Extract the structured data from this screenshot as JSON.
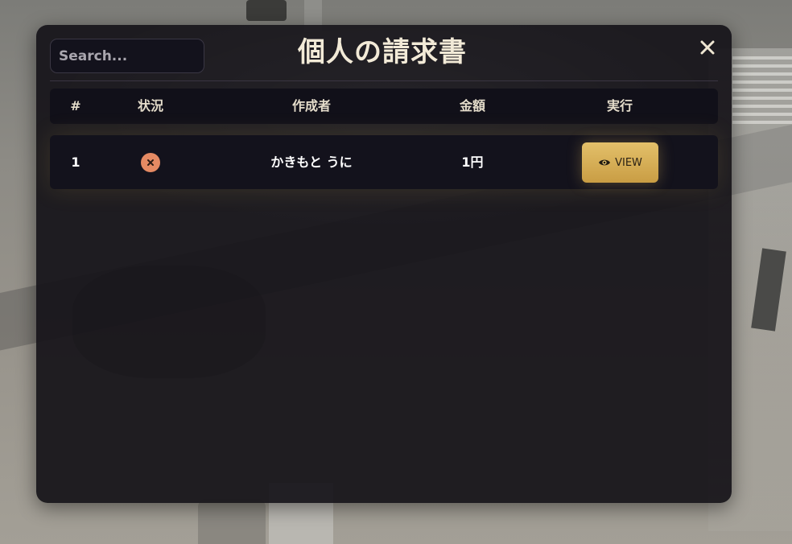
{
  "panel": {
    "title": "個人の請求書",
    "search_placeholder": "Search..."
  },
  "table": {
    "columns": [
      "#",
      "状況",
      "作成者",
      "金額",
      "実行"
    ],
    "rows": [
      {
        "id": "1",
        "status_icon": "x-circle-icon",
        "creator": "かきもと うに",
        "amount": "1円",
        "action_label": "VIEW",
        "action_icon": "eye-icon"
      }
    ]
  },
  "colors": {
    "panel_bg": "#151319",
    "accent_gold": "#d4ad58",
    "status_unpaid": "#e58a63",
    "heading_text": "#f2ead7"
  }
}
